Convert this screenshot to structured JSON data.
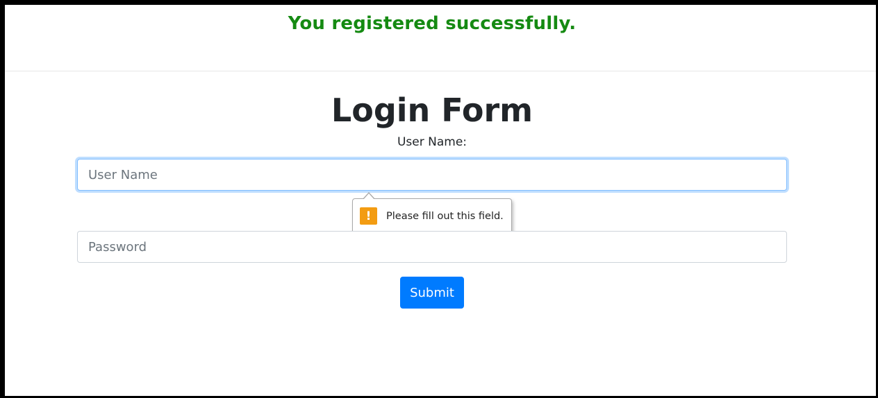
{
  "banner": {
    "message": "You registered successfully.",
    "color": "#158a12"
  },
  "form": {
    "title": "Login Form",
    "username_label": "User Name:",
    "username_placeholder": "User Name",
    "username_value": "",
    "password_placeholder": "Password",
    "password_value": "",
    "submit_label": "Submit"
  },
  "validation": {
    "icon": "warning-icon",
    "icon_glyph": "!",
    "message": "Please fill out this field."
  },
  "colors": {
    "primary": "#007bff",
    "focus": "#80bdff",
    "warning": "#f39c12"
  }
}
